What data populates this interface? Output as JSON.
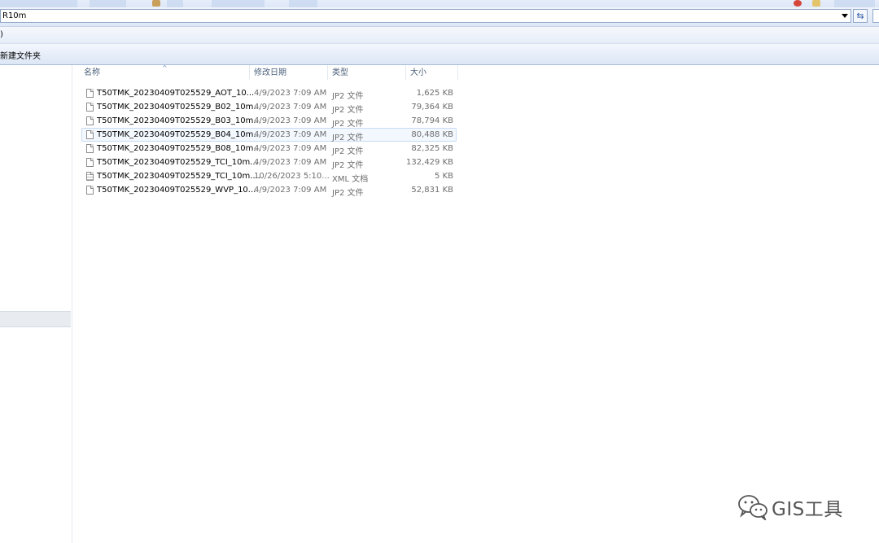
{
  "address_bar": {
    "path": "R10m"
  },
  "menu_bar": {
    "partial_item": ")"
  },
  "toolbar": {
    "new_folder": "新建文件夹"
  },
  "columns": {
    "name": "名称",
    "modified": "修改日期",
    "type": "类型",
    "size": "大小"
  },
  "files": [
    {
      "name": "T50TMK_20230409T025529_AOT_10...",
      "modified": "4/9/2023 7:09 AM",
      "type": "JP2 文件",
      "size": "1,625 KB",
      "icon": "file-icon"
    },
    {
      "name": "T50TMK_20230409T025529_B02_10m...",
      "modified": "4/9/2023 7:09 AM",
      "type": "JP2 文件",
      "size": "79,364 KB",
      "icon": "file-icon"
    },
    {
      "name": "T50TMK_20230409T025529_B03_10m...",
      "modified": "4/9/2023 7:09 AM",
      "type": "JP2 文件",
      "size": "78,794 KB",
      "icon": "file-icon"
    },
    {
      "name": "T50TMK_20230409T025529_B04_10m...",
      "modified": "4/9/2023 7:09 AM",
      "type": "JP2 文件",
      "size": "80,488 KB",
      "icon": "file-icon",
      "selected": true
    },
    {
      "name": "T50TMK_20230409T025529_B08_10m...",
      "modified": "4/9/2023 7:09 AM",
      "type": "JP2 文件",
      "size": "82,325 KB",
      "icon": "file-icon"
    },
    {
      "name": "T50TMK_20230409T025529_TCI_10m...",
      "modified": "4/9/2023 7:09 AM",
      "type": "JP2 文件",
      "size": "132,429 KB",
      "icon": "file-icon"
    },
    {
      "name": "T50TMK_20230409T025529_TCI_10m....",
      "modified": "10/26/2023 5:10...",
      "type": "XML 文档",
      "size": "5 KB",
      "icon": "xml-file-icon"
    },
    {
      "name": "T50TMK_20230409T025529_WVP_10...",
      "modified": "4/9/2023 7:09 AM",
      "type": "JP2 文件",
      "size": "52,831 KB",
      "icon": "file-icon"
    }
  ],
  "watermark": {
    "text": "GIS工具"
  },
  "colors": {
    "selection_border": "#c7daf3",
    "selection_fill": "#f3f8fe",
    "toolbar_blue": "#dce6f5"
  }
}
